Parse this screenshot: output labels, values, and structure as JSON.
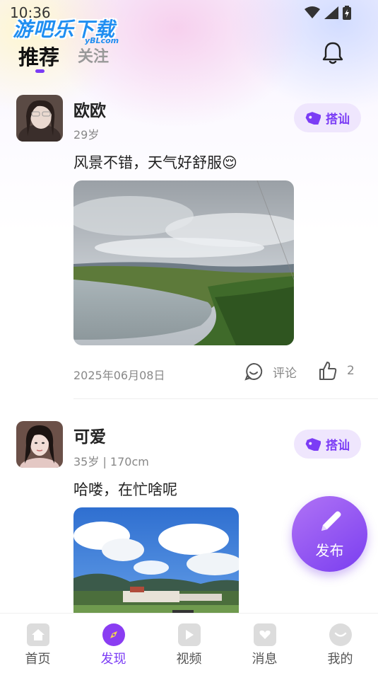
{
  "status_bar": {
    "time": "10:36"
  },
  "watermark": {
    "brand": "游吧乐下载",
    "sub": "yBLcom"
  },
  "header": {
    "tabs": [
      {
        "label": "推荐",
        "active": true
      },
      {
        "label": "关注",
        "active": false
      }
    ]
  },
  "posts": [
    {
      "name": "欧欧",
      "meta": "29岁",
      "flirt_label": "搭讪",
      "text": "风景不错，天气好舒服😌",
      "date": "2025年06月08日",
      "comment_label": "评论",
      "like_count": "2"
    },
    {
      "name": "可爱",
      "meta": "35岁 | 170cm",
      "flirt_label": "搭讪",
      "text": "哈喽，在忙啥呢"
    }
  ],
  "fab": {
    "label": "发布"
  },
  "bottom_nav": {
    "items": [
      {
        "label": "首页",
        "icon": "home-icon"
      },
      {
        "label": "发现",
        "icon": "compass-icon",
        "active": true
      },
      {
        "label": "视频",
        "icon": "video-play-icon"
      },
      {
        "label": "消息",
        "icon": "message-icon"
      },
      {
        "label": "我的",
        "icon": "profile-icon"
      }
    ]
  },
  "colors": {
    "accent": "#7b3cf5",
    "accent_light": "#efe6fd",
    "muted_text": "#888888"
  }
}
